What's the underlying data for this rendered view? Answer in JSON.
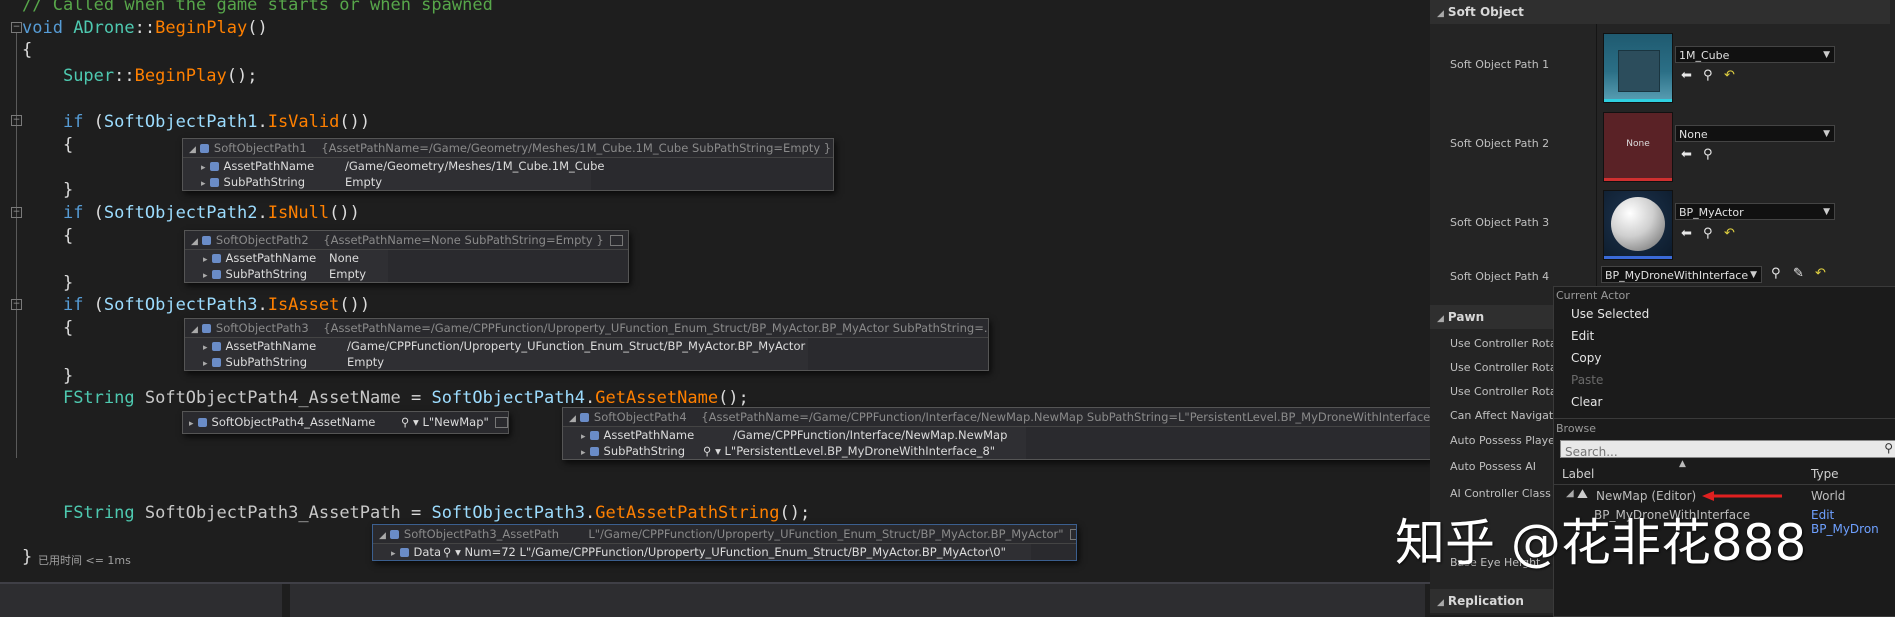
{
  "code": {
    "comment": "// Called when the game starts or when spawned",
    "l_void": "void",
    "l_class": "ADrone",
    "l_sep": "::",
    "l_method": "BeginPlay",
    "l_parens": "()",
    "brace_open": "{",
    "brace_close": "}",
    "super": "Super",
    "super_call": "BeginPlay",
    "super_end": "();",
    "if": "if",
    "paren_open": " (",
    "sop1": "SoftObjectPath1",
    "isvalid": "IsValid",
    "sop2": "SoftObjectPath2",
    "isnull": "IsNull",
    "sop3": "SoftObjectPath3",
    "isasset": "IsAsset",
    "call_close": "()",
    "if_close": ")",
    "dot": ".",
    "fstring": "FString",
    "var4": "SoftObjectPath4_AssetName",
    "eq": " = ",
    "sop4": "SoftObjectPath4",
    "getassetname": "GetAssetName",
    "stmt_end": "();",
    "var3": "SoftObjectPath3_AssetPath",
    "getassetpathstring": "GetAssetPathString",
    "status": "已用时间 <= 1ms"
  },
  "tips": {
    "t1": {
      "name": "SoftObjectPath1",
      "summary": "{AssetPathName=/Game/Geometry/Meshes/1M_Cube.1M_Cube SubPathString=Empty }",
      "r1n": "AssetPathName",
      "r1v": "/Game/Geometry/Meshes/1M_Cube.1M_Cube",
      "r2n": "SubPathString",
      "r2v": "Empty"
    },
    "t2": {
      "name": "SoftObjectPath2",
      "summary": "{AssetPathName=None SubPathString=Empty }",
      "r1n": "AssetPathName",
      "r1v": "None",
      "r2n": "SubPathString",
      "r2v": "Empty"
    },
    "t3": {
      "name": "SoftObjectPath3",
      "summary": "{AssetPathName=/Game/CPPFunction/Uproperty_UFunction_Enum_Struct/BP_MyActor.BP_MyActor SubPathString=...}",
      "r1n": "AssetPathName",
      "r1v": "/Game/CPPFunction/Uproperty_UFunction_Enum_Struct/BP_MyActor.BP_MyActor",
      "r2n": "SubPathString",
      "r2v": "Empty"
    },
    "t4a": {
      "name": "SoftObjectPath4_AssetName",
      "value": "L\"NewMap\""
    },
    "t4b": {
      "name": "SoftObjectPath4",
      "summary": "{AssetPathName=/Game/CPPFunction/Interface/NewMap.NewMap SubPathString=L\"PersistentLevel.BP_MyDroneWithInterface_8\" }",
      "r1n": "AssetPathName",
      "r1v": "/Game/CPPFunction/Interface/NewMap.NewMap",
      "r2n": "SubPathString",
      "r2v": "L\"PersistentLevel.BP_MyDroneWithInterface_8\""
    },
    "t5": {
      "name": "SoftObjectPath3_AssetPath",
      "summary": "L\"/Game/CPPFunction/Uproperty_UFunction_Enum_Struct/BP_MyActor.BP_MyActor\"",
      "r1n": "Data",
      "r1v": "Num=72 L\"/Game/CPPFunction/Uproperty_UFunction_Enum_Struct/BP_MyActor.BP_MyActor\\0\""
    }
  },
  "panel": {
    "sec_soft": "Soft Object",
    "p1": "Soft Object Path 1",
    "p2": "Soft Object Path 2",
    "p3": "Soft Object Path 3",
    "p4": "Soft Object Path 4",
    "v1": "1M_Cube",
    "v2": "None",
    "v3": "BP_MyActor",
    "v4": "BP_MyDroneWithInterface",
    "thumb_none": "None",
    "sec_pawn": "Pawn",
    "pawn_props": [
      "Use Controller Rotat",
      "Use Controller Rotat",
      "Use Controller Rotat",
      "Can Affect Navigatic",
      "Auto Possess Player",
      "Auto Possess AI",
      "AI Controller Class"
    ],
    "base_eye": "Base Eye Height",
    "sec_repl": "Replication"
  },
  "menu": {
    "current_actor": "Current Actor",
    "use_selected": "Use Selected",
    "edit": "Edit",
    "copy": "Copy",
    "paste": "Paste",
    "clear": "Clear",
    "browse": "Browse",
    "search_placeholder": "Search...",
    "col_label": "Label",
    "col_type": "Type",
    "row1_label": "NewMap (Editor)",
    "row1_type": "World",
    "row2_label": "BP_MyDroneWithInterface",
    "row2_type": "Edit BP_MyDron"
  },
  "watermark": "知乎 @花非花888",
  "colors": {
    "keyword": "#569cd6",
    "function": "#ff8000",
    "comment": "#57a64a",
    "type": "#4ec9b0",
    "arrow": "#e02020"
  }
}
